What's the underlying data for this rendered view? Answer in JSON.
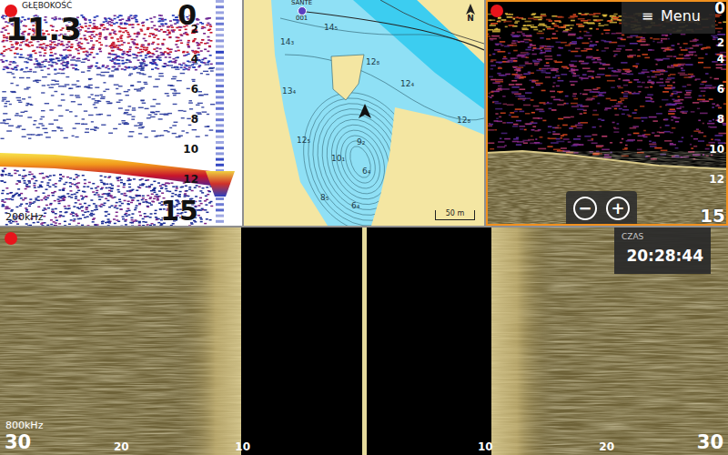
{
  "sonar": {
    "label": "GŁĘBOKOŚĆ",
    "depth": "11.3",
    "range_top": "0",
    "range_bottom": "15",
    "ticks": [
      "2",
      "4",
      "6",
      "8",
      "10",
      "12"
    ],
    "frequency": "200kHz",
    "recording": true,
    "selected": false
  },
  "map": {
    "waypoint": "SANTE",
    "waypoint_id": "001",
    "north": "N",
    "scale": "50 m",
    "soundings": [
      "14₃",
      "14₅",
      "13₄",
      "12₅",
      "12₈",
      "12₄",
      "12₈",
      "9₂",
      "10₁",
      "6₄",
      "8₅",
      "6₄"
    ],
    "selected": false
  },
  "downscan": {
    "menu_icon": "≡",
    "menu": "Menu",
    "range_top": "0",
    "ticks": [
      "2",
      "4",
      "6",
      "8",
      "10",
      "12"
    ],
    "range_bottom": "15",
    "zoom_out": "−",
    "zoom_in": "+",
    "recording": true,
    "selected": true
  },
  "sidescan": {
    "frequency": "800kHz",
    "ticks": [
      "30",
      "20",
      "10",
      "10",
      "20",
      "30"
    ],
    "recording": true,
    "selected": false
  },
  "time": {
    "label": "CZAS",
    "value": "20:28:44"
  }
}
